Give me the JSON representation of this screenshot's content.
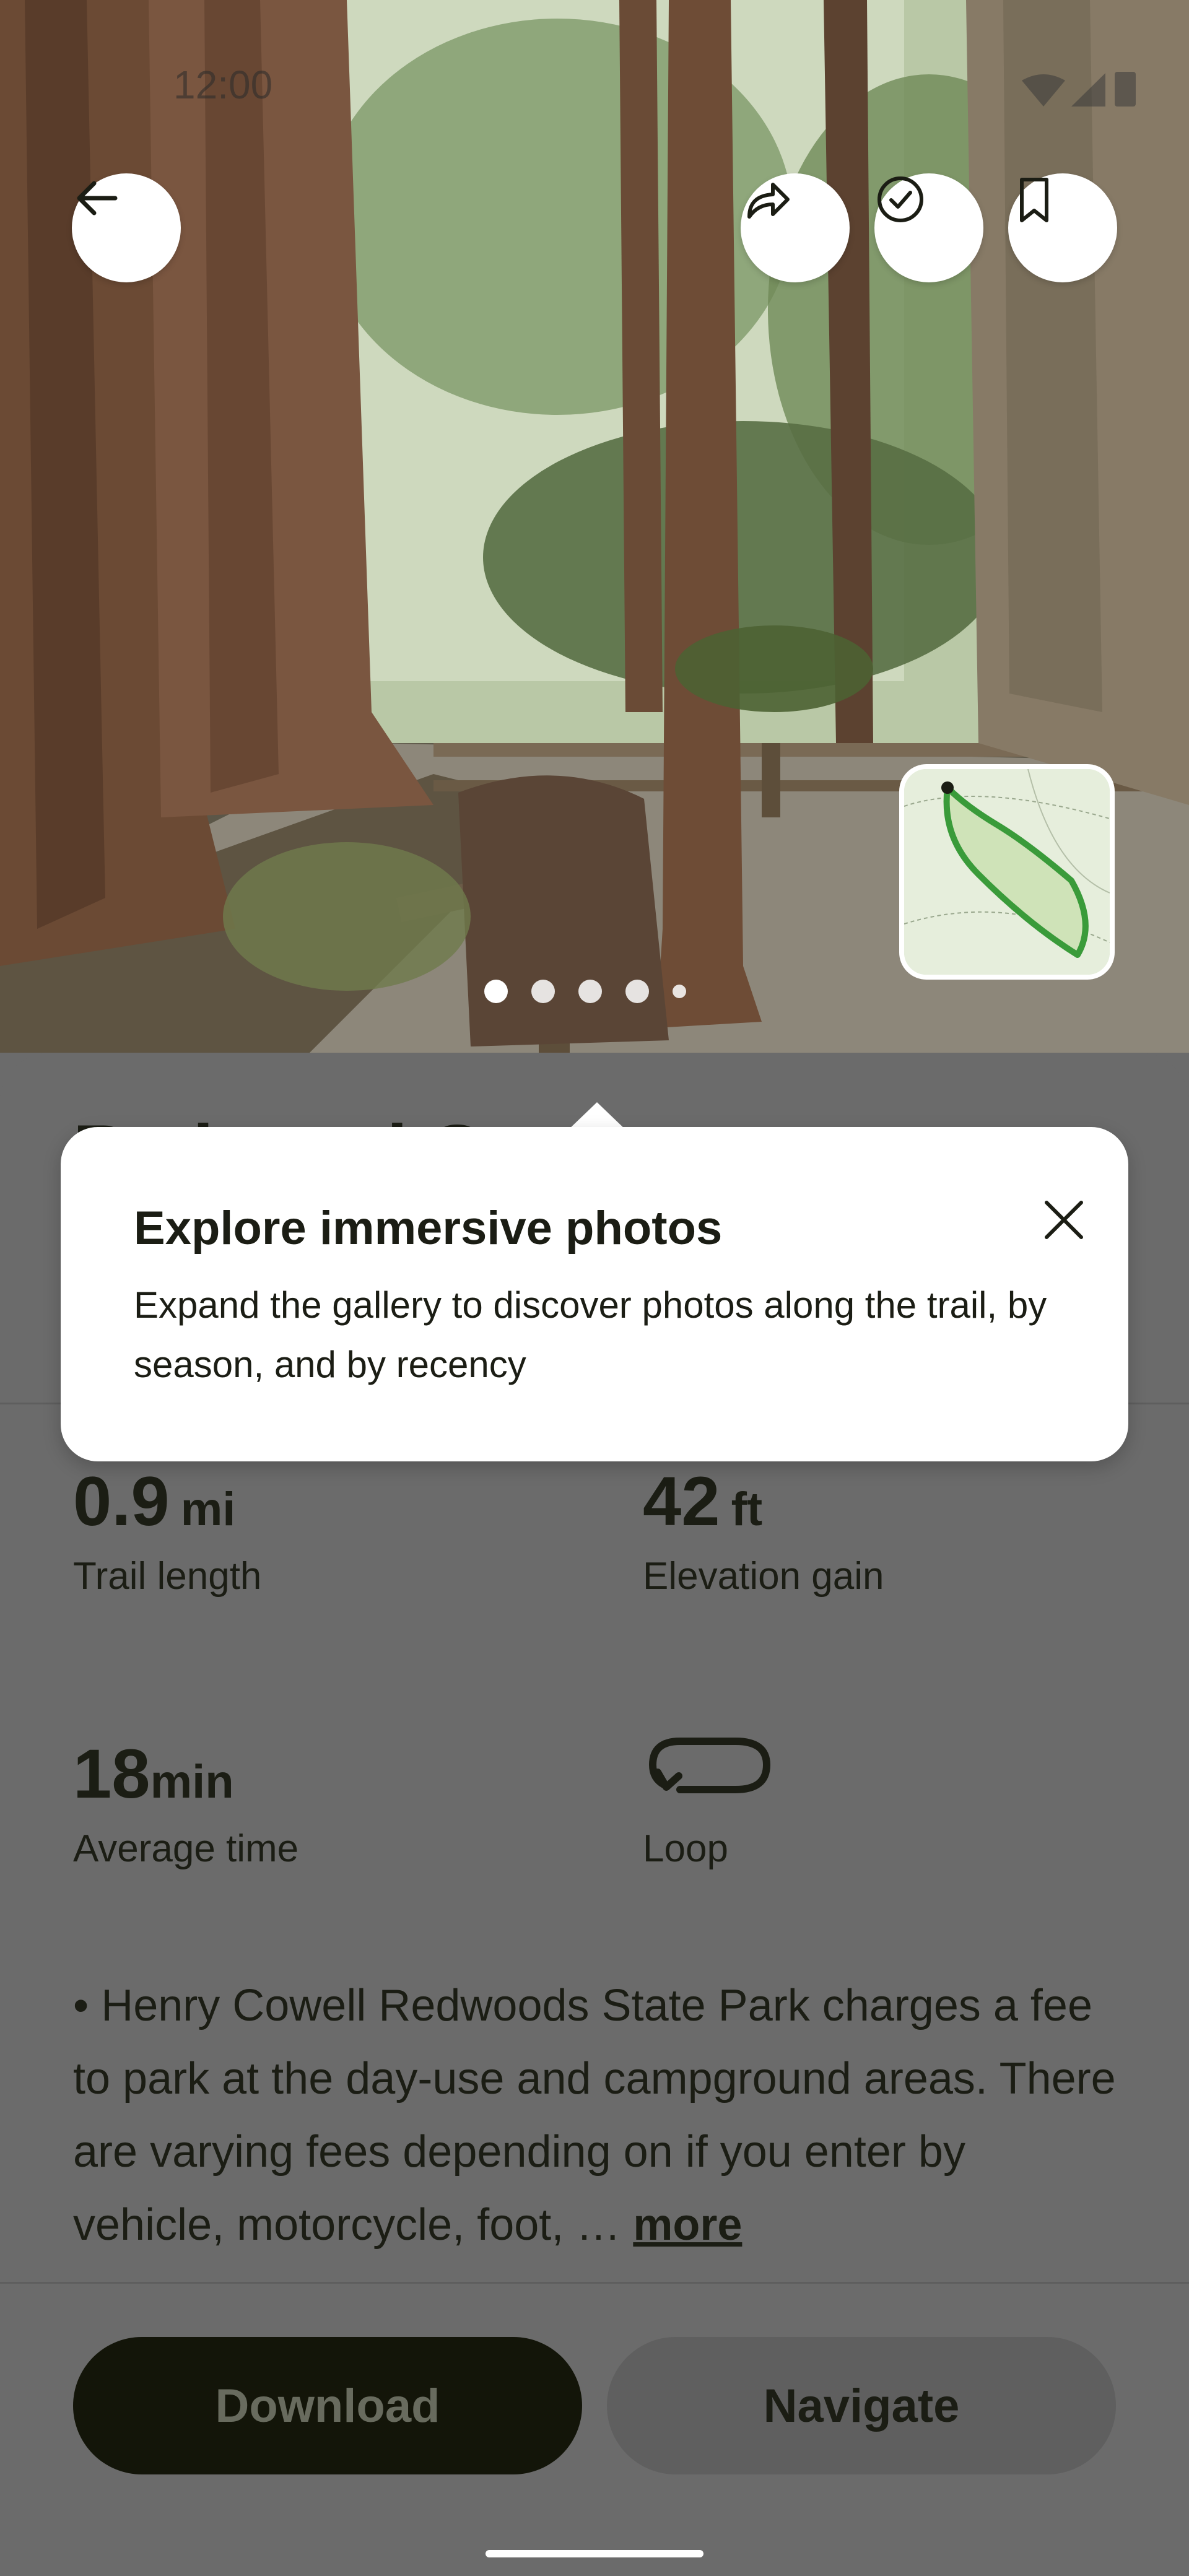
{
  "status_bar": {
    "time": "12:00"
  },
  "top_actions": {
    "back": "back",
    "share": "share",
    "complete": "complete",
    "save": "save"
  },
  "gallery": {
    "page_count": 5,
    "active_index": 0
  },
  "trail": {
    "title_partial": "Redwood G"
  },
  "tooltip": {
    "title": "Explore immersive photos",
    "body": "Expand the gallery to discover photos along the trail, by season, and by recency"
  },
  "stats": {
    "length_value": "0.9",
    "length_unit": "mi",
    "length_label": "Trail length",
    "elevation_value": "42",
    "elevation_unit": "ft",
    "elevation_label": "Elevation gain",
    "time_value": "18",
    "time_unit": "min",
    "time_label": "Average time",
    "route_type_label": "Loop"
  },
  "description": {
    "text": "• Henry Cowell Redwoods State Park charges a fee to park at the day-use and campground areas. There are varying fees depending on if you enter by vehicle, motorcycle, foot, ",
    "ellipsis": "… ",
    "more_label": "more"
  },
  "buttons": {
    "download": "Download",
    "navigate": "Navigate"
  },
  "colors": {
    "dark_text": "#1b1d14",
    "download_bg": "#131509",
    "scrim": "#6b6b6b",
    "map_route": "#3a9b3a"
  }
}
